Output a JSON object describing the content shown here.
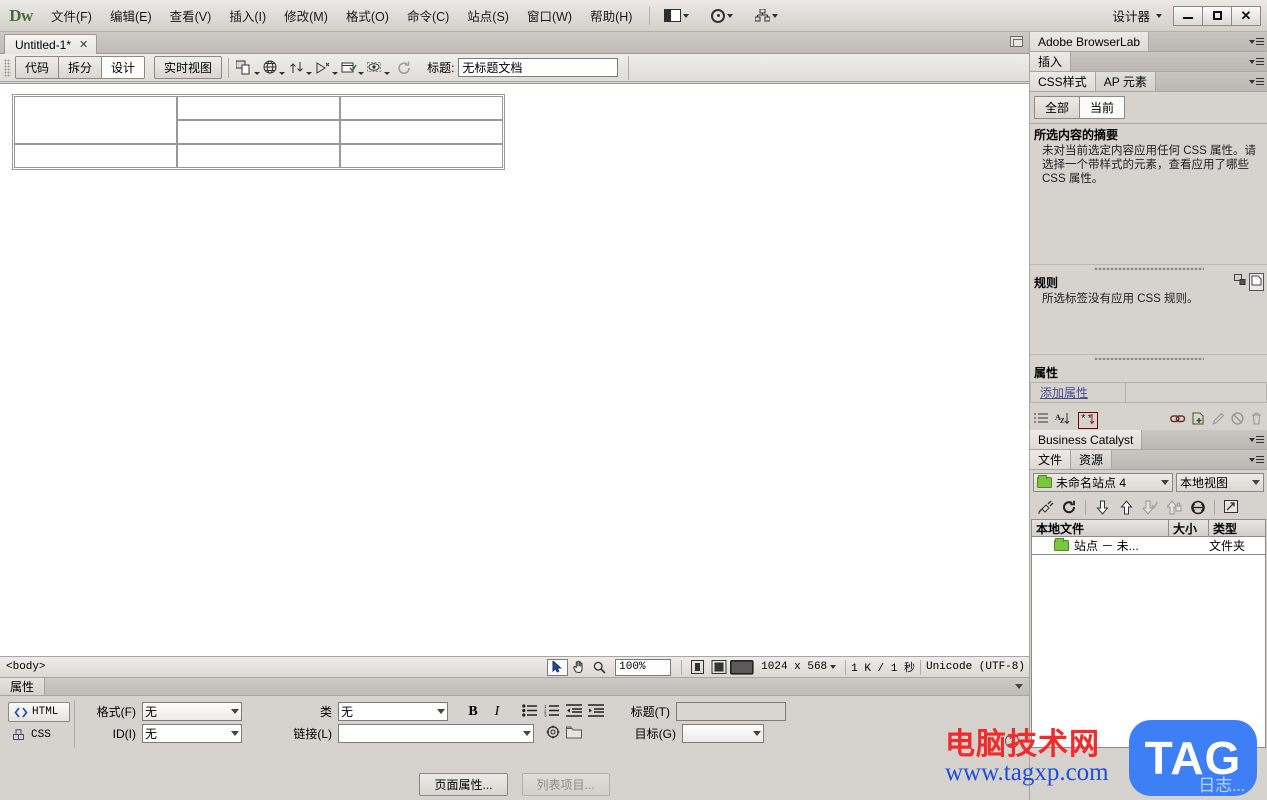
{
  "app": {
    "logo": "Dw",
    "workspace_label": "设计器",
    "menus": [
      "文件(F)",
      "编辑(E)",
      "查看(V)",
      "插入(I)",
      "修改(M)",
      "格式(O)",
      "命令(C)",
      "站点(S)",
      "窗口(W)",
      "帮助(H)"
    ],
    "toolbar_icons": [
      "layout-switcher-icon",
      "gear-icon",
      "site-tree-icon"
    ],
    "window_controls": {
      "minimize": "—",
      "maximize": "□",
      "close": "✕"
    }
  },
  "document": {
    "tab_label": "Untitled-1*",
    "tab_close": "✕",
    "view_buttons": [
      {
        "label": "代码",
        "active": false
      },
      {
        "label": "拆分",
        "active": false
      },
      {
        "label": "设计",
        "active": true
      }
    ],
    "live_view_button": "实时视图",
    "toolbar_icons": [
      "multiscreen-icon",
      "preview-browser-icon",
      "file-management-icon",
      "validate-icon",
      "check-browser-icon",
      "visual-aids-icon",
      "refresh-icon"
    ],
    "title_label": "标题:",
    "title_value": "无标题文档"
  },
  "canvas": {
    "table": {
      "rows": 3,
      "cols": 3,
      "merged_first_column_rowspan": 2,
      "cells": [
        [
          "",
          "",
          ""
        ],
        [
          "",
          ""
        ],
        [
          "",
          "",
          ""
        ]
      ]
    }
  },
  "status_bar": {
    "tag_selector": "<body>",
    "tools": [
      "select-tool-icon",
      "hand-tool-icon",
      "zoom-tool-icon"
    ],
    "zoom_value": "100%",
    "zoom_options": [
      "100%"
    ],
    "window_size_icons": [
      "phone-size-icon",
      "tablet-size-icon",
      "desktop-size-icon"
    ],
    "dimensions": "1024 x 568",
    "download_size": "1 K / 1 秒",
    "encoding": "Unicode (UTF-8)"
  },
  "right_dock": {
    "browserlab": {
      "title": "Adobe BrowserLab"
    },
    "insert": {
      "title": "插入"
    },
    "css_panel": {
      "tabs": [
        {
          "label": "CSS样式",
          "active": true
        },
        {
          "label": "AP 元素",
          "active": false
        }
      ],
      "mode_buttons": [
        {
          "label": "全部",
          "active": false
        },
        {
          "label": "当前",
          "active": true
        }
      ],
      "summary_heading": "所选内容的摘要",
      "summary_text": "未对当前选定内容应用任何 CSS 属性。请选择一个带样式的元素，查看应用了哪些 CSS 属性。",
      "rules_heading": "规则",
      "rules_text": "所选标签没有应用 CSS 规则。",
      "properties_heading": "属性",
      "add_property_label": "添加属性",
      "footer_icons": [
        "category-view-icon",
        "list-view-icon",
        "set-properties-icon",
        "attach-stylesheet-icon",
        "new-rule-icon",
        "edit-rule-icon",
        "disable-property-icon",
        "delete-property-icon"
      ]
    },
    "business_catalyst": {
      "title": "Business Catalyst"
    },
    "files_panel": {
      "tabs": [
        {
          "label": "文件",
          "active": true
        },
        {
          "label": "资源",
          "active": false
        }
      ],
      "site_name": "未命名站点 4",
      "view_mode": "本地视图",
      "toolbar_icons": [
        "connect-icon",
        "refresh-icon",
        "get-files-icon",
        "put-files-icon",
        "check-out-icon",
        "check-in-icon",
        "synchronize-icon",
        "expand-panel-icon"
      ],
      "columns": [
        "本地文件",
        "大小",
        "类型"
      ],
      "rows": [
        {
          "name": "站点 － 未...",
          "size": "",
          "type": "文件夹",
          "icon": "folder-icon"
        }
      ]
    }
  },
  "properties_panel": {
    "tab_label": "属性",
    "html_button": "HTML",
    "css_button": "CSS",
    "format_label": "格式(F)",
    "format_value": "无",
    "id_label": "ID(I)",
    "id_value": "无",
    "class_label": "类",
    "class_value": "无",
    "link_label": "链接(L)",
    "link_value": "",
    "bold_label": "B",
    "italic_label": "I",
    "list_icons": [
      "unordered-list-icon",
      "ordered-list-icon",
      "outdent-icon",
      "indent-icon"
    ],
    "title_label": "标题(T)",
    "title_value": "",
    "target_label": "目标(G)",
    "target_value": "",
    "page_properties_button": "页面属性...",
    "list_item_button": "列表项目...",
    "help_icon": "help-icon"
  },
  "watermark": {
    "line1": "电脑技术网",
    "line2": "www.tagxp.com",
    "badge": "TAG",
    "ghost": "日志..."
  },
  "colors": {
    "accent_green": "#4a6b3f",
    "chrome": "#d6d3ce",
    "watermark_red": "#ef2b2b",
    "watermark_blue": "#1f4fd8",
    "badge_blue": "#3f7ff5"
  }
}
